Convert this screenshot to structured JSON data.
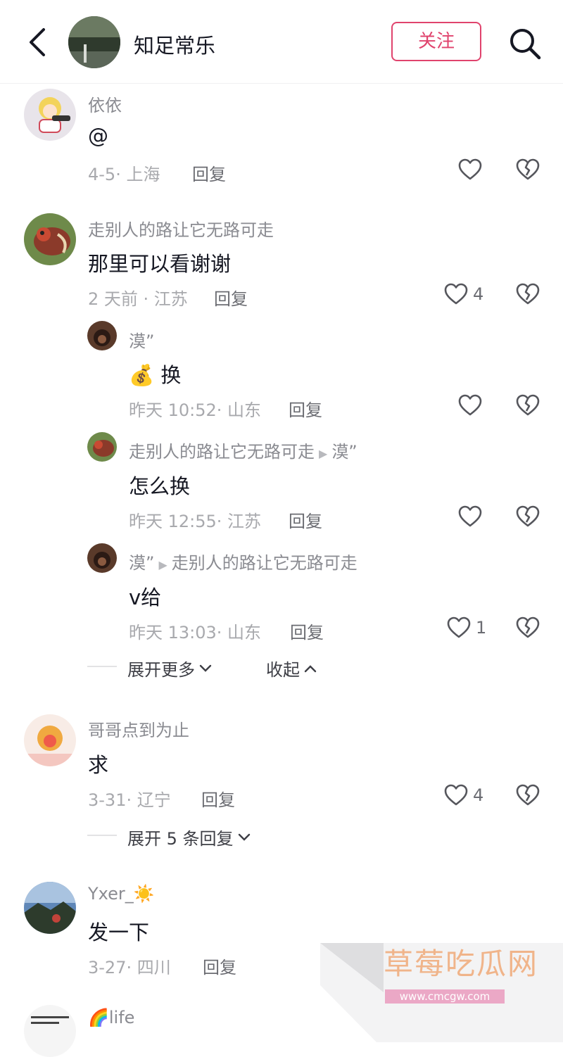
{
  "header": {
    "title": "知足常乐",
    "follow_label": "关注"
  },
  "comments": [
    {
      "username": "依依",
      "content": "@",
      "meta": "4-5· 上海",
      "reply_label": "回复",
      "like_count": ""
    },
    {
      "username": "走别人的路让它无路可走",
      "content": "那里可以看谢谢",
      "meta": "2 天前 · 江苏",
      "reply_label": "回复",
      "like_count": "4",
      "replies": [
        {
          "username": "漠”",
          "reply_to": "",
          "content_emoji": "💰",
          "content": "换",
          "meta": "昨天 10:52· 山东",
          "reply_label": "回复",
          "like_count": ""
        },
        {
          "username": "走别人的路让它无路可走",
          "reply_to": "漠”",
          "content": "怎么换",
          "meta": "昨天 12:55· 江苏",
          "reply_label": "回复",
          "like_count": ""
        },
        {
          "username": "漠”",
          "reply_to": "走别人的路让它无路可走",
          "content": "v给",
          "meta": "昨天 13:03· 山东",
          "reply_label": "回复",
          "like_count": "1"
        }
      ],
      "expand_more_label": "展开更多",
      "collapse_label": "收起"
    },
    {
      "username": "哥哥点到为止",
      "content": "求",
      "meta": "3-31· 辽宁",
      "reply_label": "回复",
      "like_count": "4",
      "expand_replies_label": "展开 5 条回复"
    },
    {
      "username": "Yxer_",
      "username_emoji": "☀️",
      "content": "发一下",
      "meta": "3-27· 四川",
      "reply_label": "回复"
    },
    {
      "username_emoji": "🌈",
      "username": "life"
    }
  ],
  "watermark": {
    "title": "草莓吃瓜网",
    "url": "www.cmcgw.com"
  },
  "colors": {
    "accent": "#e0436d",
    "text_primary": "#161823",
    "text_secondary": "#8a8b91",
    "icon": "#55565c"
  }
}
